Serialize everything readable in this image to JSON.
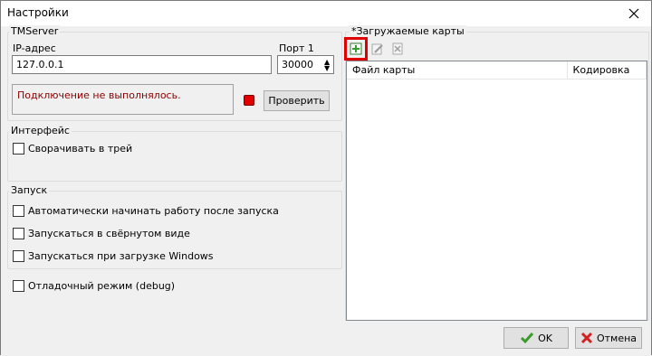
{
  "window": {
    "title": "Настройки"
  },
  "tmserver": {
    "group_title": "TMServer",
    "ip_label": "IP-адрес",
    "ip_value": "127.0.0.1",
    "port_label": "Порт 1",
    "port_value": "30000",
    "status_text": "Подключение не выполнялось.",
    "status_color": "#e00000",
    "check_button": "Проверить"
  },
  "interface": {
    "group_title": "Интерфейс",
    "minimize_to_tray": "Сворачивать в трей"
  },
  "startup": {
    "group_title": "Запуск",
    "auto_start": "Автоматически начинать работу после запуска",
    "start_minimized": "Запускаться в свёрнутом виде",
    "start_with_windows": "Запускаться при загрузке Windows"
  },
  "debug": {
    "label": "Отладочный режим (debug)"
  },
  "maps": {
    "group_title": "*Загружаемые карты",
    "columns": [
      "Файл карты",
      "Кодировка"
    ],
    "toolbar_icons": [
      "add-map-icon",
      "edit-map-icon",
      "delete-map-icon"
    ]
  },
  "footer": {
    "ok_label": "OK",
    "cancel_label": "Отмена"
  }
}
